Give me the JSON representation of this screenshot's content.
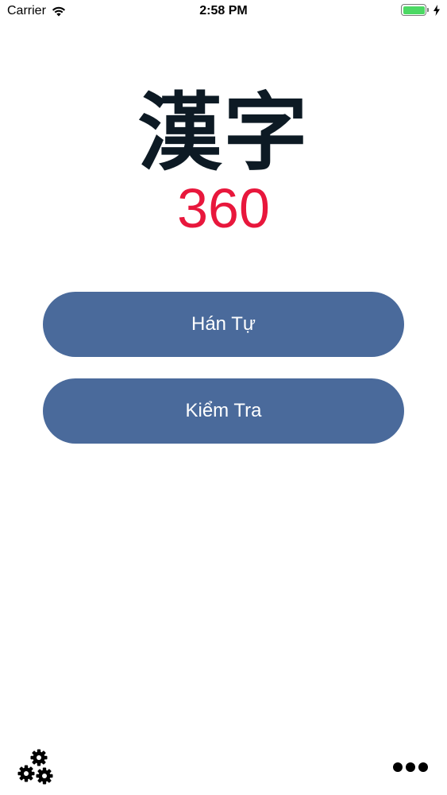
{
  "status_bar": {
    "carrier": "Carrier",
    "time": "2:58 PM",
    "battery_color": "#4cd964"
  },
  "logo": {
    "kanji": "漢字",
    "number": "360",
    "kanji_color": "#0d1a24",
    "number_color": "#e8173c"
  },
  "menu": {
    "buttons": [
      {
        "label": "Hán Tự"
      },
      {
        "label": "Kiểm Tra"
      }
    ],
    "button_color": "#4a6a9b"
  },
  "toolbar": {
    "left_icon": "settings-gears-icon",
    "right_icon": "more-dots-icon"
  }
}
